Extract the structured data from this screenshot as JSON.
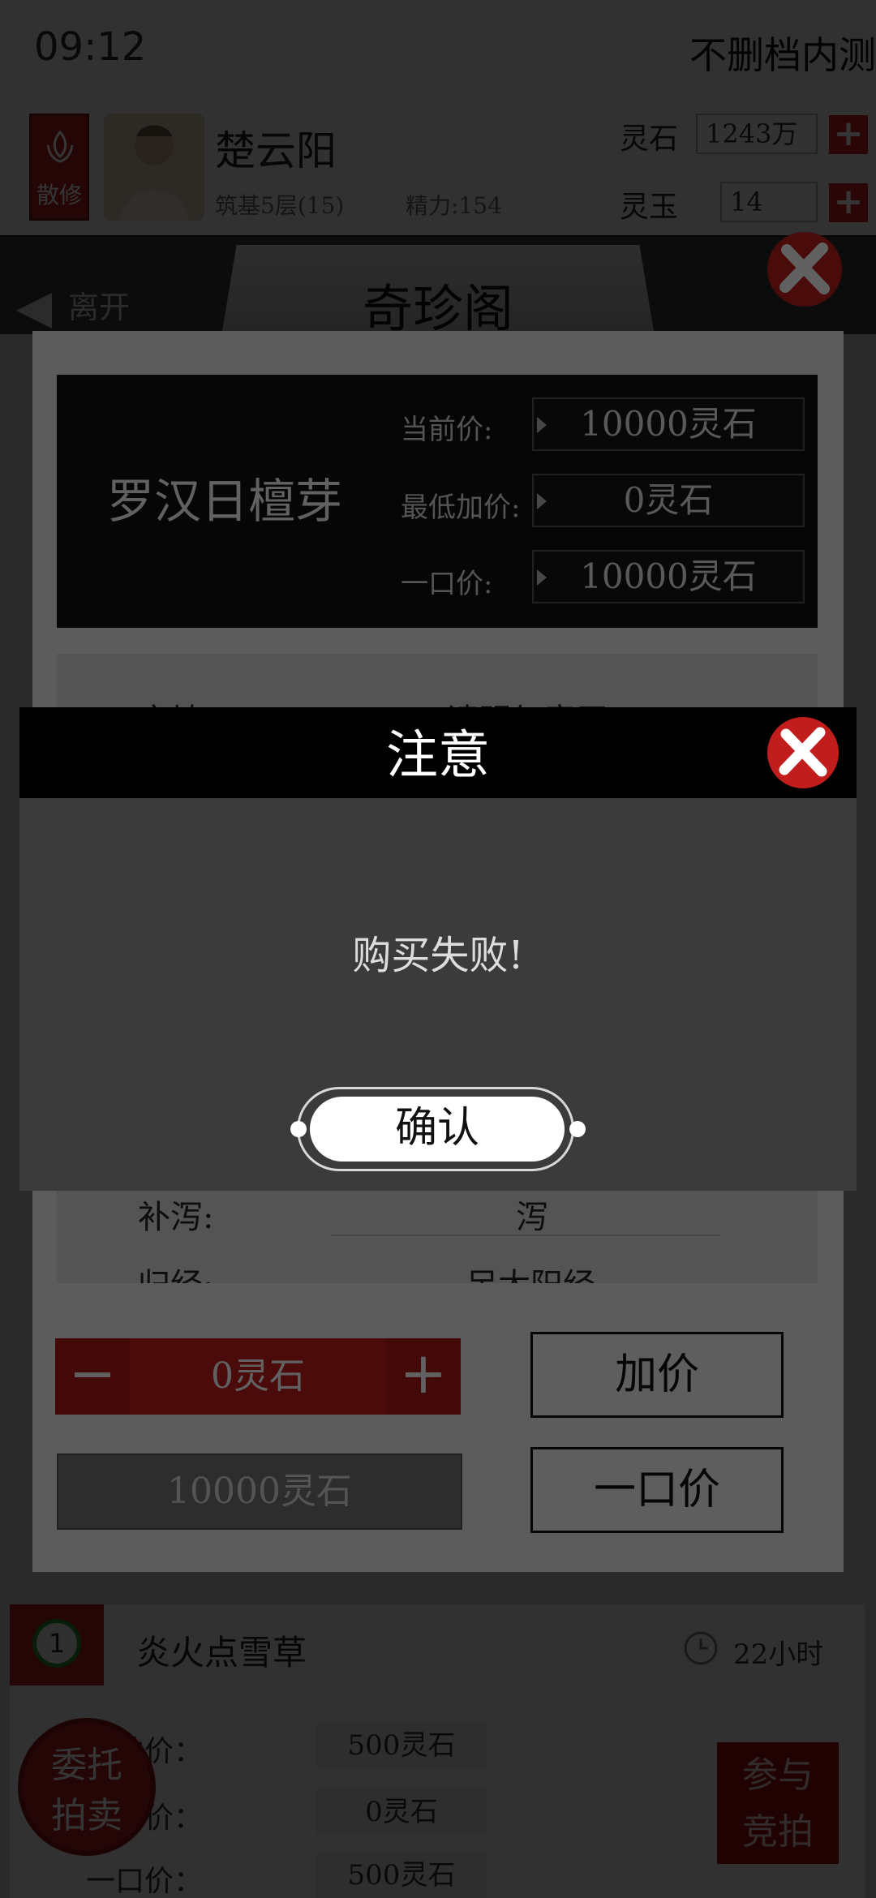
{
  "status_bar": {
    "time": "09:12",
    "build_label": "不删档内测"
  },
  "player": {
    "sect_badge": "散修",
    "name": "楚云阳",
    "level": "筑基5层(15)",
    "stamina": "精力:154",
    "resources": [
      {
        "label": "灵石",
        "value": "1243万"
      },
      {
        "label": "灵玉",
        "value": "14"
      }
    ]
  },
  "shop": {
    "leave_label": "离开",
    "title": "奇珍阁"
  },
  "listings": [
    {
      "index": "1",
      "name": "炎火点雪草",
      "time_left": "22小时",
      "rows": [
        {
          "label": "起拍价：",
          "value": "500灵石"
        },
        {
          "label": "当前价：",
          "value": "0灵石"
        },
        {
          "label": "一口价：",
          "value": "500灵石"
        }
      ]
    }
  ],
  "footer": {
    "join_label": "参与\n竞拍",
    "consign_label": "委托\n拍卖"
  },
  "detail": {
    "item_name": "罗汉日檀芽",
    "prices": [
      {
        "label": "当前价:",
        "value": "10000灵石"
      },
      {
        "label": "最低加价:",
        "value": "0灵石"
      },
      {
        "label": "一口价:",
        "value": "10000灵石"
      }
    ],
    "attributes": [
      {
        "label": "产地:",
        "value": "请明何意无"
      },
      {
        "label": "补泻:",
        "value": "泻"
      },
      {
        "label": "归经:",
        "value": "足太阳经"
      }
    ],
    "bid_amount": "0灵石",
    "buyout_amount": "10000灵石",
    "raise_label": "加价",
    "buyout_label": "一口价"
  },
  "alert": {
    "title": "注意",
    "message": "购买失败!",
    "confirm_label": "确认"
  },
  "colors": {
    "accent_red": "#b01818",
    "alert_header": "#000000",
    "alert_body": "#3b3b3b"
  }
}
